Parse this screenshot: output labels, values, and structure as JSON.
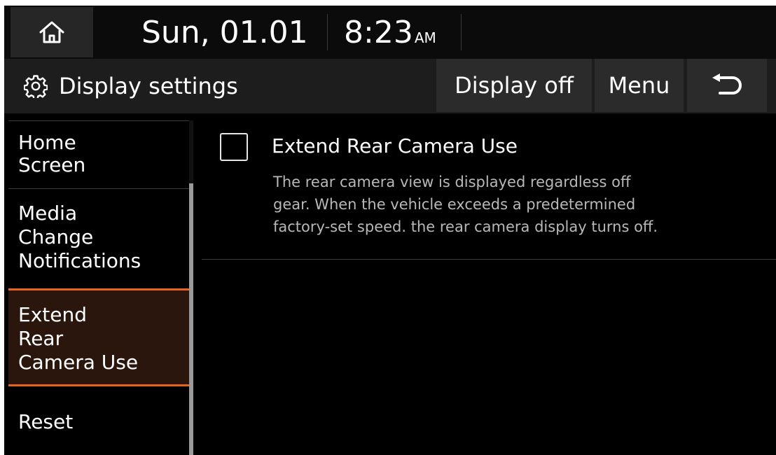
{
  "status_bar": {
    "date": "Sun, 01.01",
    "time": "8:23",
    "ampm": "AM"
  },
  "title_bar": {
    "title": "Display settings",
    "display_off_label": "Display off",
    "menu_label": "Menu"
  },
  "icons": {
    "home": "home-icon",
    "gear": "gear-icon",
    "back": "back-arrow-icon"
  },
  "sidebar": {
    "items": [
      {
        "lines": [
          "Home",
          "Screen"
        ],
        "selected": false
      },
      {
        "lines": [
          "Media",
          "Change",
          "Notifications"
        ],
        "selected": false
      },
      {
        "lines": [
          "Extend",
          "Rear",
          "Camera Use"
        ],
        "selected": true
      },
      {
        "lines": [
          "Reset"
        ],
        "selected": false
      }
    ]
  },
  "content": {
    "option": {
      "title": "Extend Rear Camera Use",
      "checked": false,
      "description_lines": [
        "The rear camera view is displayed regardless off",
        "gear. When the vehicle exceeds a predetermined",
        "factory-set speed. the rear camera display turns off."
      ]
    }
  },
  "colors": {
    "accent": "#e8631f",
    "selected_bg": "#2b160e",
    "background": "#000000"
  }
}
